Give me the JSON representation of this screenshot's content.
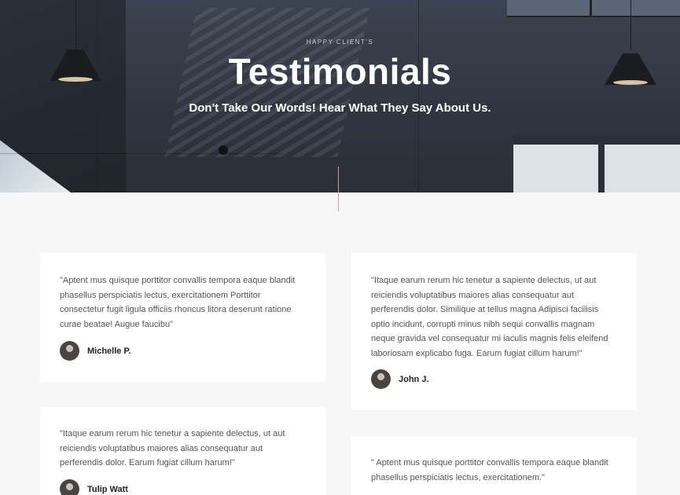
{
  "hero": {
    "eyebrow": "HAPPY CLIENT'S",
    "title": "Testimonials",
    "subtitle": "Don't Take Our Words! Hear What They Say About Us."
  },
  "testimonials": [
    {
      "quote": "\"Aptent mus quisque porttitor convallis tempora eaque blandit phasellus perspiciatis lectus, exercitationem Porttitor consectetur fugit ligula officiis rhoncus litora deserunt ratione curae beatae! Augue faucibu\"",
      "author": "Michelle P."
    },
    {
      "quote": "\"Itaque earum rerum hic tenetur a sapiente delectus, ut aut reiciendis voluptatibus maiores alias consequatur aut perferendis dolor. Similique at tellus magna Adipisci facilisis optio incidunt, corrupti minus nibh sequi convallis magnam neque gravida vel consequatur mi iaculis magnis felis eleifend laboriosam explicabo fuga. Earum fugiat cillum harum!\"",
      "author": "John J."
    },
    {
      "quote": "\"Itaque earum rerum hic tenetur a sapiente delectus, ut aut reiciendis voluptatibus maiores alias consequatur aut perferendis dolor. Earum fugiat cillum harum!\"",
      "author": "Tulip Watt"
    },
    {
      "quote": "\" Aptent mus quisque porttitor convallis tempora eaque blandit phasellus perspiciatis lectus, exercitationem.\"",
      "author": ""
    }
  ]
}
